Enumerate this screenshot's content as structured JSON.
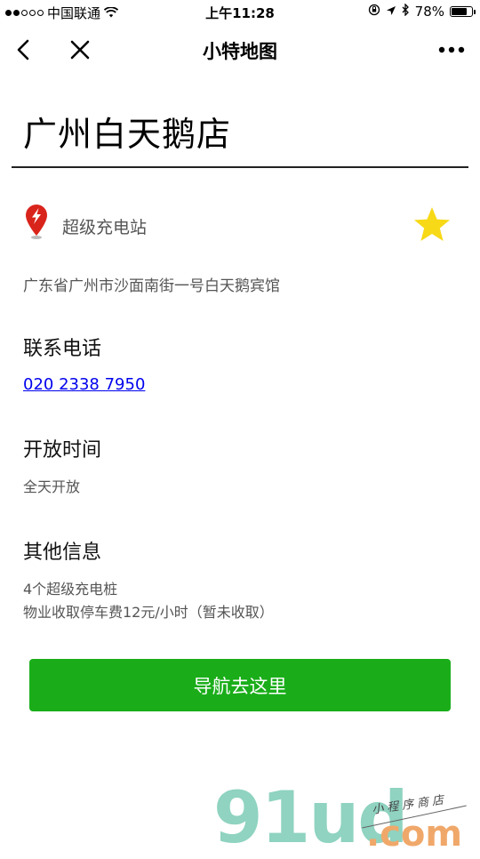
{
  "status_bar": {
    "carrier": "中国联通",
    "time": "上午11:28",
    "battery_text": "78%",
    "battery_level": 0.78,
    "signal_dots_filled": 2,
    "signal_dots_total": 5
  },
  "nav": {
    "title": "小特地图",
    "back_icon": "chevron-left-icon",
    "close_icon": "close-icon",
    "more_icon": "more-dots-icon"
  },
  "place": {
    "name": "广州白天鹅店",
    "category": "超级充电站",
    "category_icon": "map-pin-lightning-icon",
    "favorite_icon": "star-icon",
    "address": "广东省广州市沙面南街一号白天鹅宾馆"
  },
  "contact": {
    "heading": "联系电话",
    "phone": "020 2338 7950"
  },
  "hours": {
    "heading": "开放时间",
    "value": "全天开放"
  },
  "other": {
    "heading": "其他信息",
    "line1": "4个超级充电桩",
    "line2": "物业收取停车费12元/小时（暂未收取）"
  },
  "actions": {
    "navigate_label": "导航去这里"
  },
  "watermark": {
    "brand": "91ud",
    "suffix": ".com",
    "tagline": "小程序商店"
  },
  "colors": {
    "accent_green": "#1aad19",
    "link_blue": "#0000ee",
    "star_yellow": "#f7d917",
    "pin_red": "#d9241b"
  }
}
